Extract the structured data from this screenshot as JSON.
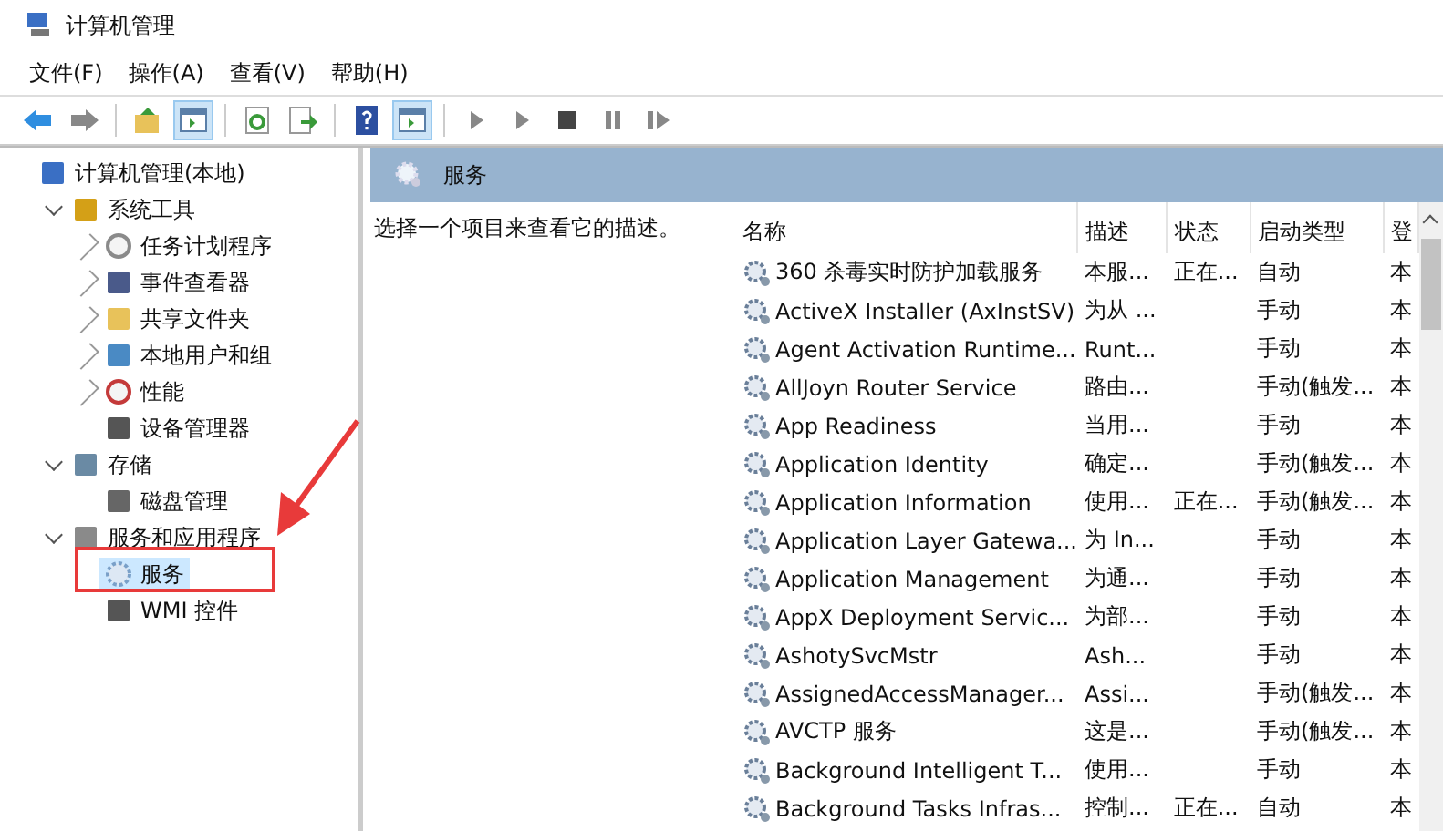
{
  "window": {
    "title": "计算机管理"
  },
  "menu": [
    "文件(F)",
    "操作(A)",
    "查看(V)",
    "帮助(H)"
  ],
  "toolbar": [
    {
      "kind": "back",
      "pressed": false
    },
    {
      "kind": "forward",
      "pressed": false
    },
    {
      "kind": "sep"
    },
    {
      "kind": "up",
      "pressed": false
    },
    {
      "kind": "tree",
      "pressed": true
    },
    {
      "kind": "sep"
    },
    {
      "kind": "refresh",
      "pressed": false
    },
    {
      "kind": "export",
      "pressed": false
    },
    {
      "kind": "sep"
    },
    {
      "kind": "help",
      "pressed": false
    },
    {
      "kind": "action",
      "pressed": true
    },
    {
      "kind": "sep"
    },
    {
      "kind": "start",
      "pressed": false
    },
    {
      "kind": "start",
      "pressed": false
    },
    {
      "kind": "stop",
      "pressed": false
    },
    {
      "kind": "pause",
      "pressed": false
    },
    {
      "kind": "restart",
      "pressed": false
    }
  ],
  "tree": [
    {
      "label": "计算机管理(本地)",
      "kind": "computer",
      "selected": false,
      "children": [
        {
          "label": "系统工具",
          "kind": "tools",
          "expanded": true,
          "selected": false,
          "children": [
            {
              "label": "任务计划程序",
              "kind": "clock",
              "expanded": false,
              "selected": false
            },
            {
              "label": "事件查看器",
              "kind": "log",
              "expanded": false,
              "selected": false
            },
            {
              "label": "共享文件夹",
              "kind": "folder",
              "expanded": false,
              "selected": false
            },
            {
              "label": "本地用户和组",
              "kind": "users",
              "expanded": false,
              "selected": false
            },
            {
              "label": "性能",
              "kind": "gauge",
              "expanded": false,
              "selected": false
            },
            {
              "label": "设备管理器",
              "kind": "device",
              "selected": false
            }
          ]
        },
        {
          "label": "存储",
          "kind": "storage",
          "expanded": true,
          "selected": false,
          "children": [
            {
              "label": "磁盘管理",
              "kind": "disk",
              "selected": false
            }
          ]
        },
        {
          "label": "服务和应用程序",
          "kind": "server",
          "expanded": true,
          "selected": false,
          "children": [
            {
              "label": "服务",
              "kind": "gear",
              "selected": true
            },
            {
              "label": "WMI 控件",
              "kind": "device",
              "selected": false
            }
          ]
        }
      ]
    }
  ],
  "panel": {
    "title": "服务",
    "description": "选择一个项目来查看它的描述。"
  },
  "table": {
    "columns": [
      "名称",
      "描述",
      "状态",
      "启动类型",
      "登"
    ],
    "rows": [
      [
        "360 杀毒实时防护加载服务",
        "本服...",
        "正在...",
        "自动",
        "本"
      ],
      [
        "ActiveX Installer (AxInstSV)",
        "为从 ...",
        "",
        "手动",
        "本"
      ],
      [
        "Agent Activation Runtime...",
        "Runt...",
        "",
        "手动",
        "本"
      ],
      [
        "AllJoyn Router Service",
        "路由...",
        "",
        "手动(触发...",
        "本"
      ],
      [
        "App Readiness",
        "当用...",
        "",
        "手动",
        "本"
      ],
      [
        "Application Identity",
        "确定...",
        "",
        "手动(触发...",
        "本"
      ],
      [
        "Application Information",
        "使用...",
        "正在...",
        "手动(触发...",
        "本"
      ],
      [
        "Application Layer Gatewa...",
        "为 In...",
        "",
        "手动",
        "本"
      ],
      [
        "Application Management",
        "为通...",
        "",
        "手动",
        "本"
      ],
      [
        "AppX Deployment Servic...",
        "为部...",
        "",
        "手动",
        "本"
      ],
      [
        "AshotySvcMstr",
        "Ash...",
        "",
        "手动",
        "本"
      ],
      [
        "AssignedAccessManager...",
        "Assi...",
        "",
        "手动(触发...",
        "本"
      ],
      [
        "AVCTP 服务",
        "这是...",
        "",
        "手动(触发...",
        "本"
      ],
      [
        "Background Intelligent T...",
        "使用...",
        "",
        "手动",
        "本"
      ],
      [
        "Background Tasks Infras...",
        "控制...",
        "正在...",
        "自动",
        "本"
      ]
    ]
  }
}
